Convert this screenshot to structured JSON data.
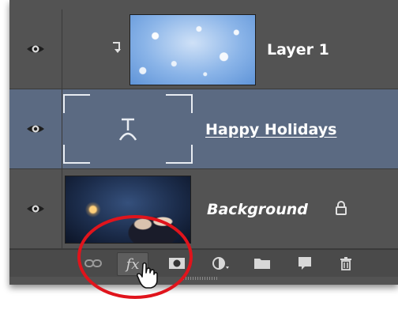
{
  "layers_panel": {
    "layers": [
      {
        "name": "Layer 1",
        "thumbnail": "snowflake-bokeh-image",
        "clipped": true,
        "visible": true,
        "selected": false
      },
      {
        "name": "Happy Holidays",
        "thumbnail": "type-layer-icon",
        "clipped": false,
        "visible": true,
        "selected": true
      },
      {
        "name": "Background",
        "thumbnail": "couple-in-snow-photo",
        "locked": true,
        "visible": true,
        "selected": false
      }
    ],
    "toolbar": {
      "buttons": [
        {
          "name": "link-layers-icon"
        },
        {
          "name": "fx-icon",
          "label": "fx"
        },
        {
          "name": "add-layer-mask-icon"
        },
        {
          "name": "new-adjustment-layer-icon"
        },
        {
          "name": "new-group-folder-icon"
        },
        {
          "name": "new-layer-icon"
        },
        {
          "name": "delete-layer-trash-icon"
        }
      ]
    }
  },
  "colors": {
    "panel_bg": "#535353",
    "selected_row": "#5b6a82",
    "highlight_circle": "#e0141c"
  }
}
